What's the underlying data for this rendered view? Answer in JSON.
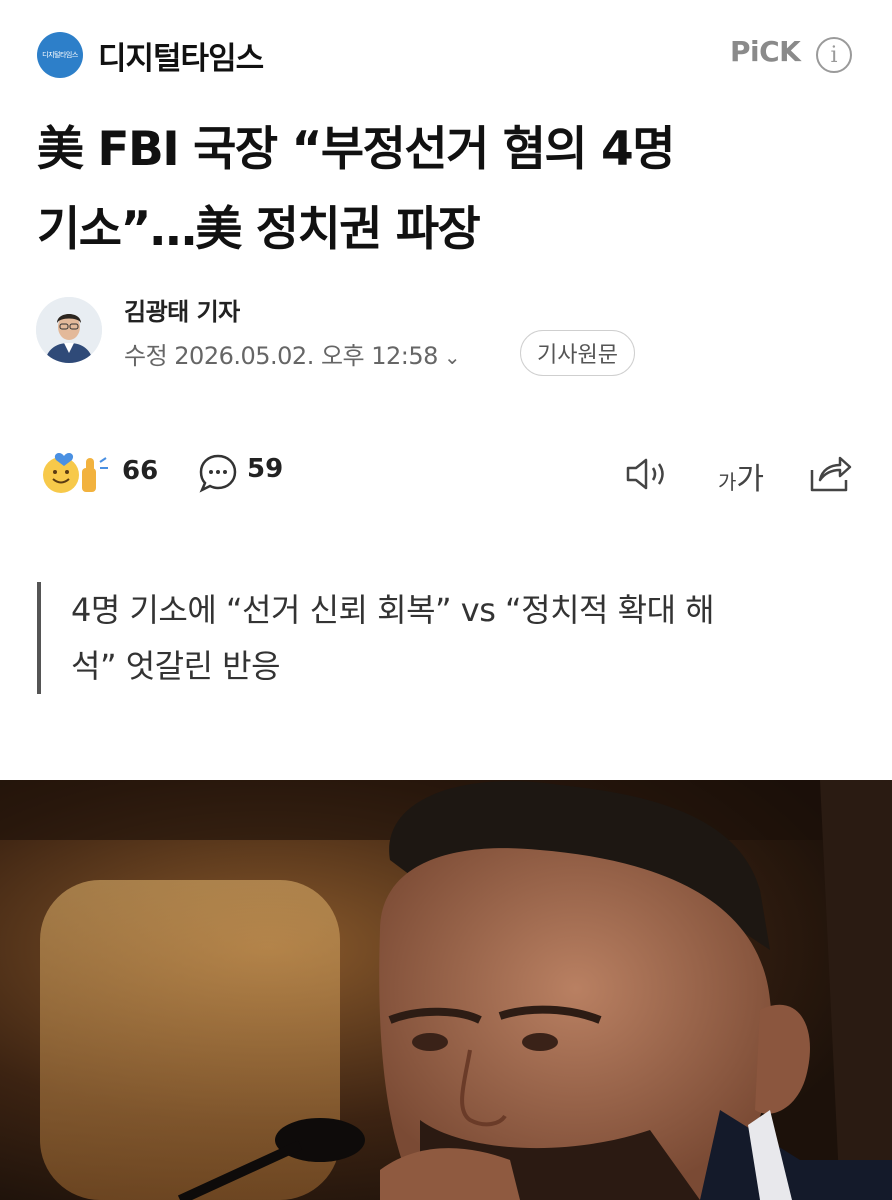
{
  "press": {
    "logo_text": "디지털타임스",
    "name": "디지털타임스",
    "pick_label": "PiCK",
    "info_icon": "info-icon"
  },
  "article": {
    "headline_line1": "美 FBI 국장 “부정선거 혐의 4명",
    "headline_line2": "기소”…美 정치권 파장",
    "reporter": "김광태 기자",
    "modified": "수정 2026.05.02. 오후 12:58",
    "original_button": "기사원문",
    "summary_line1": "4명 기소에 “선거 신뢰 회복” vs “정치적 확대 해",
    "summary_line2": "석” 엇갈린 반응"
  },
  "actions": {
    "reaction_count": "66",
    "comment_count": "59",
    "font_small": "가",
    "font_large": "가",
    "icons": [
      "reaction-icon",
      "comment-icon",
      "speaker-icon",
      "font-size-icon",
      "share-icon"
    ]
  },
  "colors": {
    "logo_blue": "#2d7fc9",
    "pick_gray": "#8a8a8a",
    "text_dark": "#111111",
    "meta_gray": "#666666"
  }
}
